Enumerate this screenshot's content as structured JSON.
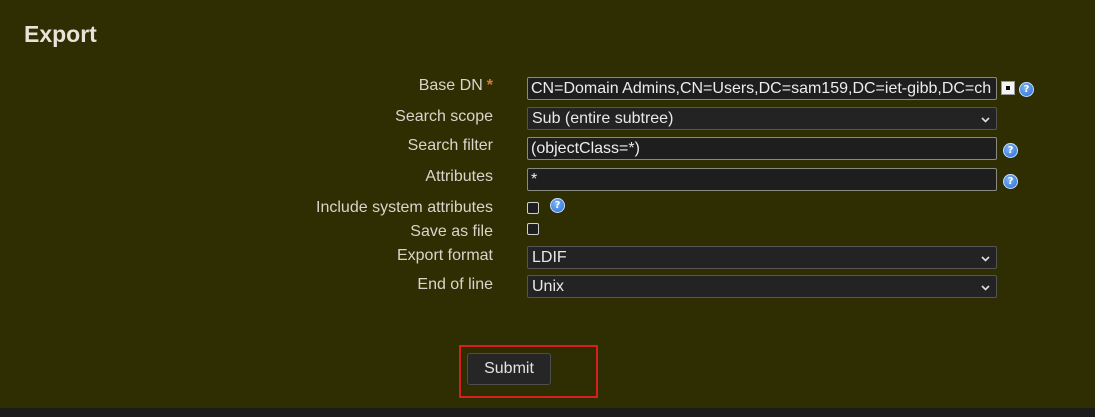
{
  "form": {
    "title": "Export",
    "base_dn": {
      "label": "Base DN",
      "required_mark": "*",
      "value": "CN=Domain Admins,CN=Users,DC=sam159,DC=iet-gibb,DC=ch"
    },
    "search_scope": {
      "label": "Search scope",
      "selected": "Sub (entire subtree)"
    },
    "search_filter": {
      "label": "Search filter",
      "value": "(objectClass=*)"
    },
    "attributes": {
      "label": "Attributes",
      "value": "*"
    },
    "include_system_attributes": {
      "label": "Include system attributes",
      "checked": false
    },
    "save_as_file": {
      "label": "Save as file",
      "checked": false
    },
    "export_format": {
      "label": "Export format",
      "selected": "LDIF"
    },
    "end_of_line": {
      "label": "End of line",
      "selected": "Unix"
    },
    "submit_label": "Submit"
  },
  "icons": {
    "help": "help-icon",
    "dn_picker": "entry-picker-icon",
    "dropdown": "chevron-down-icon"
  },
  "colors": {
    "background": "#2f2d02",
    "required": "#e07b2c",
    "highlight": "#d61f1f",
    "help": "#2a6fd6"
  }
}
